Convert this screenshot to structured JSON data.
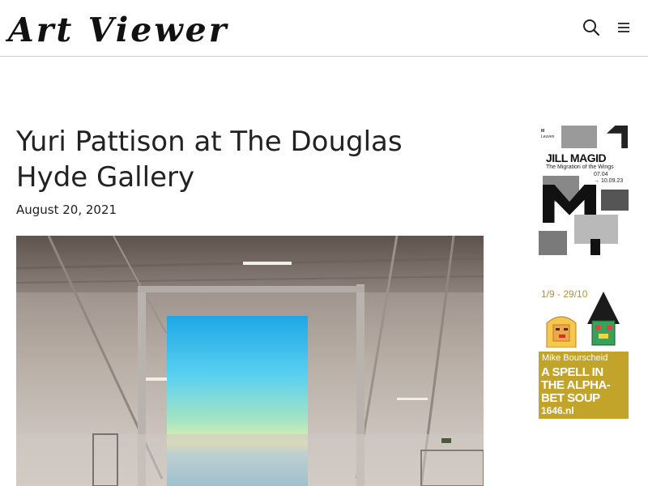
{
  "site": {
    "logo_text": "Art Viewer"
  },
  "header": {
    "search_icon": "search-icon",
    "menu_icon": "hamburger-menu-icon"
  },
  "article": {
    "title": "Yuri Pattison at The Douglas Hyde Gallery",
    "date": "August 20, 2021"
  },
  "ads": {
    "ad1": {
      "museum_line1": "M",
      "museum_line2": "Leuven",
      "artist": "JILL MAGID",
      "subtitle": "The Migration of the Wings",
      "date_start": "07.04",
      "date_end": "→ 10.09.23"
    },
    "ad2": {
      "dates": "1/9 - 29/10",
      "artist": "Mike Bourscheid",
      "line1": "A SPELL IN",
      "line2": "THE ALPHA-",
      "line3": "BET SOUP",
      "website": "1646.nl",
      "bg_color": "#c3a42b"
    }
  }
}
